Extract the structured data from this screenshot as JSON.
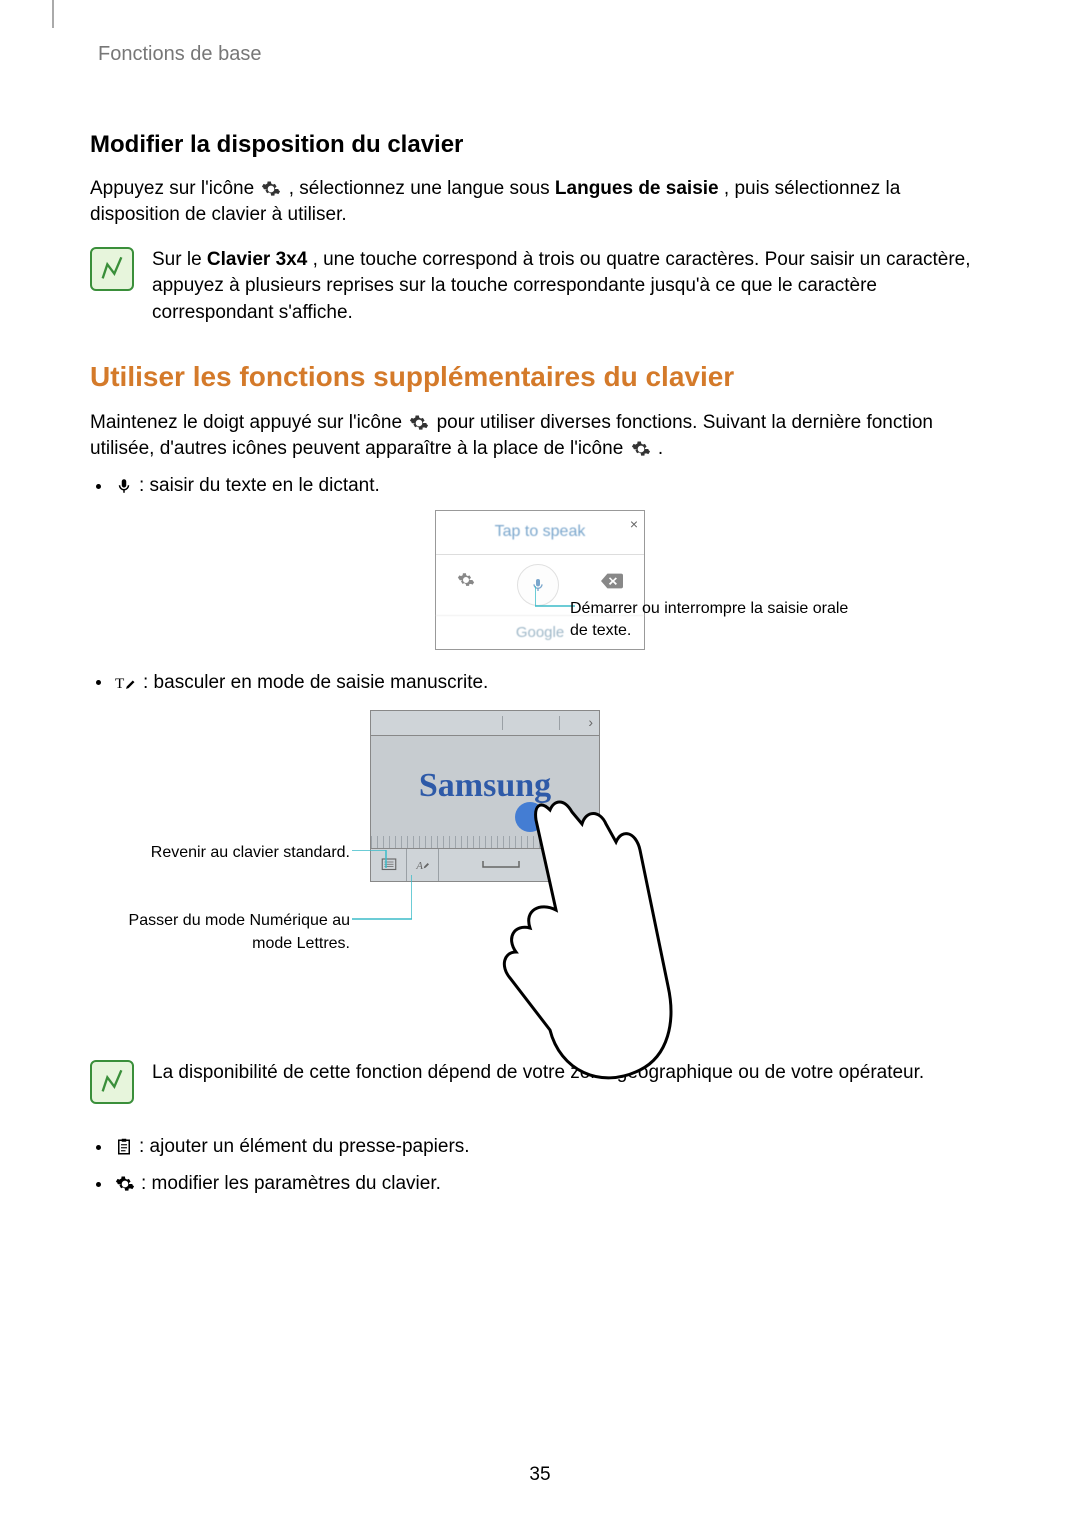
{
  "header": "Fonctions de base",
  "section1": {
    "title": "Modifier la disposition du clavier",
    "para_pre": "Appuyez sur l'icône ",
    "para_post": ", sélectionnez une langue sous ",
    "para_bold": "Langues de saisie",
    "para_end": ", puis sélectionnez la disposition de clavier à utiliser.",
    "note_pre": "Sur le ",
    "note_bold": "Clavier 3x4",
    "note_post": ", une touche correspond à trois ou quatre caractères. Pour saisir un caractère, appuyez à plusieurs reprises sur la touche correspondante jusqu'à ce que le caractère correspondant s'affiche."
  },
  "section2": {
    "title": "Utiliser les fonctions supplémentaires du clavier",
    "para_pre": "Maintenez le doigt appuyé sur l'icône ",
    "para_mid": " pour utiliser diverses fonctions. Suivant la dernière fonction utilisée, d'autres icônes peuvent apparaître à la place de l'icône ",
    "para_end": "."
  },
  "bullets": {
    "mic": " : saisir du texte en le dictant.",
    "pen": " : basculer en mode de saisie manuscrite.",
    "clip": " : ajouter un élément du presse-papiers.",
    "gear": " : modifier les paramètres du clavier."
  },
  "voice_panel": {
    "tap": "Tap to speak",
    "brand": "Google"
  },
  "callouts": {
    "voice": "Démarrer ou interrompre la saisie orale de texte.",
    "return_kb": "Revenir au clavier standard.",
    "switch_mode": "Passer du mode Numérique au mode Lettres."
  },
  "handwriting_word": "Samsung",
  "note2": "La disponibilité de cette fonction dépend de votre zone géographique ou de votre opérateur.",
  "page_number": "35"
}
